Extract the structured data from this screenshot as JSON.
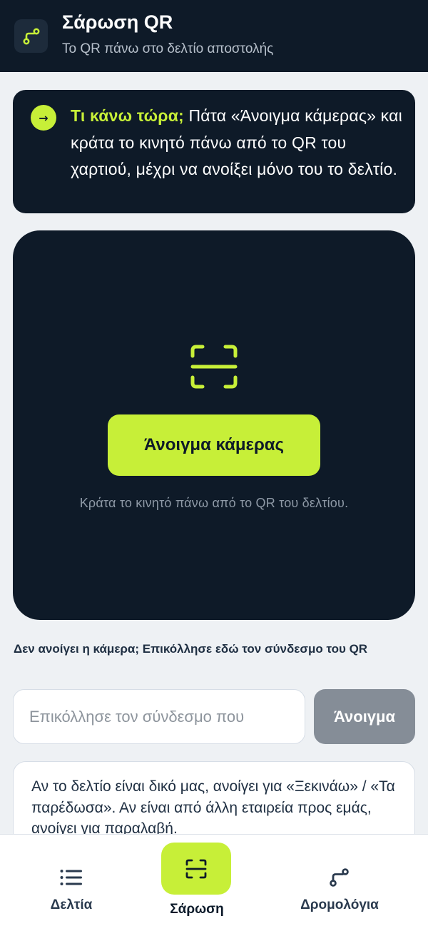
{
  "header": {
    "title": "Σάρωση QR",
    "subtitle": "Το QR πάνω στο δελτίο αποστολής",
    "logo_icon": "route-icon"
  },
  "info": {
    "icon": "arrow-right-icon",
    "arrow_glyph": "→",
    "lead": "Τι κάνω τώρα;",
    "text": " Πάτα «Άνοιγμα κάμερας» και κράτα το κινητό πάνω από το QR του χαρτιού, μέχρι να ανοίξει μόνο του το δελτίο."
  },
  "scanner": {
    "icon": "scan-frame-icon",
    "camera_button": "Άνοιγμα κάμερας",
    "hint": "Κράτα το κινητό πάνω από το QR του δελτίου."
  },
  "paste": {
    "label": "Δεν ανοίγει η κάμερα; Επικόλλησε εδώ τον σύνδεσμο του QR",
    "placeholder": "Επικόλλησε τον σύνδεσμο που",
    "value": "",
    "button": "Άνοιγμα"
  },
  "note": {
    "text": "Αν το δελτίο είναι δικό μας, ανοίγει για «Ξεκινάω» / «Τα παρέδωσα». Αν είναι από άλλη εταιρεία προς εμάς, ανοίγει για παραλαβή."
  },
  "tabs": [
    {
      "label": "Δελτία",
      "icon": "list-icon",
      "active": false
    },
    {
      "label": "Σάρωση",
      "icon": "scan-icon",
      "active": true
    },
    {
      "label": "Δρομολόγια",
      "icon": "route-icon",
      "active": false
    }
  ],
  "colors": {
    "navy": "#0e1a28",
    "accent": "#c7ef38",
    "background": "#eef1f4",
    "disabled_button": "#858d97"
  }
}
